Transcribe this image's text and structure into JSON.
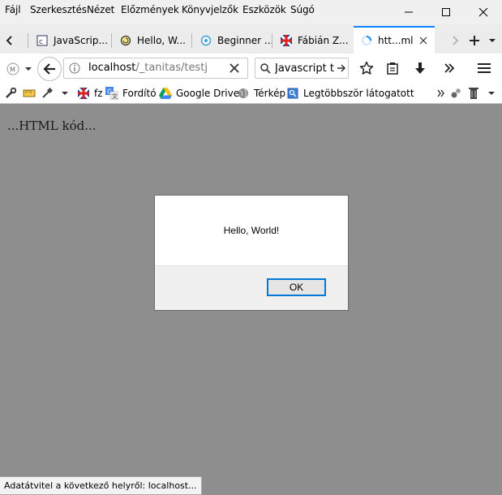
{
  "menu": {
    "items": [
      {
        "label": "Fájl",
        "id": "file"
      },
      {
        "label": "Szerkesztés",
        "id": "edit"
      },
      {
        "label": "Nézet",
        "id": "view"
      },
      {
        "label": "Előzmények",
        "id": "history"
      },
      {
        "label": "Könyvjelzők",
        "id": "bookmarks"
      },
      {
        "label": "Eszközök",
        "id": "tools"
      },
      {
        "label": "Súgó",
        "id": "help"
      }
    ]
  },
  "tabs": [
    {
      "label": "JavaScrip...",
      "icon": "js-favicon"
    },
    {
      "label": "Hello, W...",
      "icon": "snail-favicon"
    },
    {
      "label": "Beginner ...",
      "icon": "globe-favicon"
    },
    {
      "label": "Fábián Z...",
      "icon": "flag-favicon"
    },
    {
      "label": "htt...ml",
      "icon": "loading-spinner",
      "active": true
    }
  ],
  "navbar": {
    "url_host": "localhost",
    "url_path": "/_tanitas/testj",
    "search_value": "Javascript t"
  },
  "bookmarks": [
    {
      "label": "fz",
      "icon": "flag-favicon"
    },
    {
      "label": "Fordító",
      "icon": "translate-favicon"
    },
    {
      "label": "Google Drive",
      "icon": "drive-favicon"
    },
    {
      "label": "Térkép",
      "icon": "globe-favicon"
    },
    {
      "label": "Legtöbbször látogatott",
      "icon": "folder-favicon"
    }
  ],
  "page": {
    "text": "...HTML kód..."
  },
  "dialog": {
    "message": "Hello, World!",
    "ok_label": "OK"
  },
  "status": {
    "text": "Adatátvitel a következő helyről: localhost..."
  },
  "colors": {
    "accent": "#0a84ff",
    "content_overlay": "#8e8e8e",
    "ok_border": "#0078d7"
  }
}
